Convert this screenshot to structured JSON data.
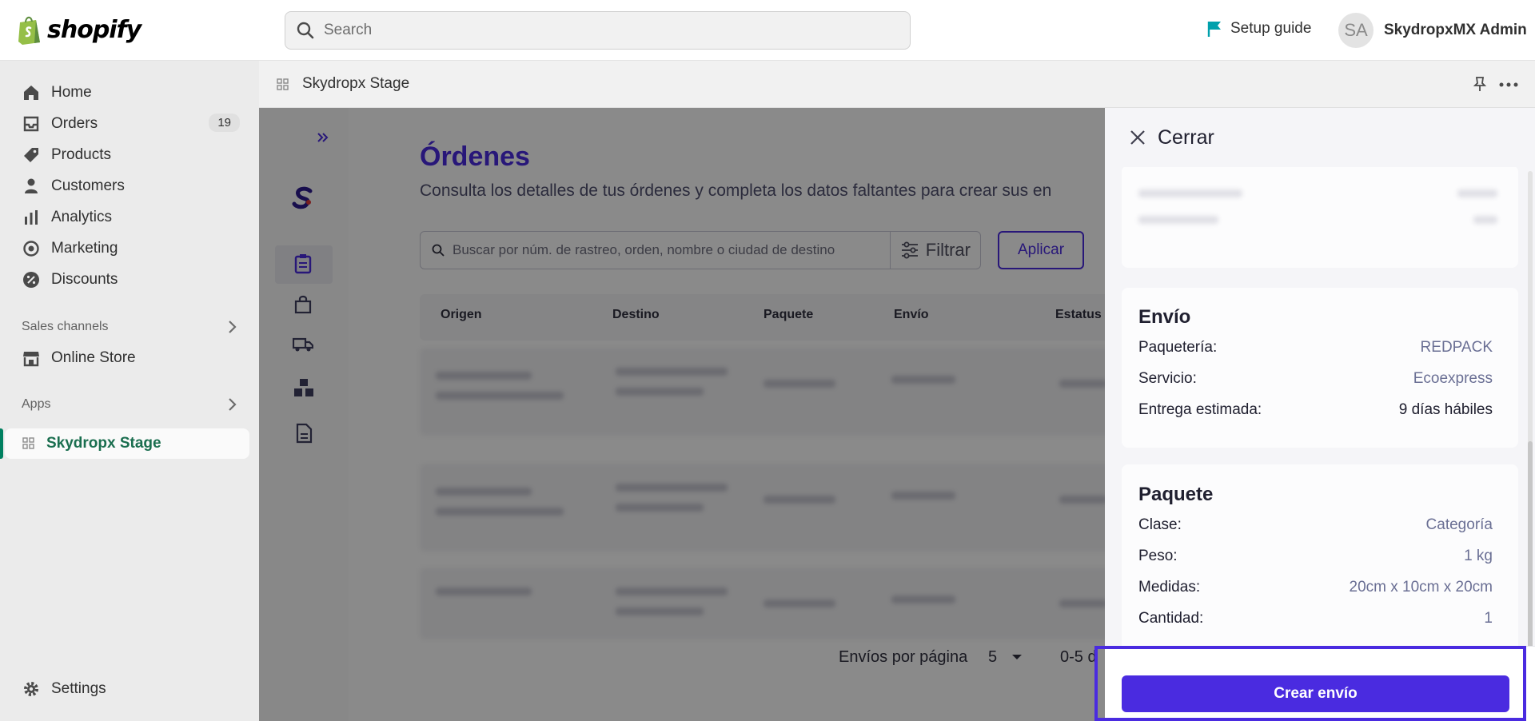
{
  "topbar": {
    "brand": "shopify",
    "search_placeholder": "Search",
    "setup_guide": "Setup guide",
    "avatar_initials": "SA",
    "user_name": "SkydropxMX Admin"
  },
  "sidebar": {
    "items": [
      {
        "label": "Home",
        "icon": "home-icon"
      },
      {
        "label": "Orders",
        "icon": "inbox-icon",
        "badge": "19"
      },
      {
        "label": "Products",
        "icon": "tag-icon"
      },
      {
        "label": "Customers",
        "icon": "person-icon"
      },
      {
        "label": "Analytics",
        "icon": "bar-chart-icon"
      },
      {
        "label": "Marketing",
        "icon": "target-icon"
      },
      {
        "label": "Discounts",
        "icon": "discount-icon"
      }
    ],
    "sales_channels_label": "Sales channels",
    "online_store": "Online Store",
    "apps_label": "Apps",
    "active_app": "Skydropx Stage",
    "settings": "Settings"
  },
  "app_header": {
    "title": "Skydropx Stage"
  },
  "app": {
    "title": "Órdenes",
    "subtitle": "Consulta los detalles de tus órdenes y completa los datos faltantes para crear sus en",
    "search_placeholder": "Buscar por núm. de rastreo, orden, nombre o ciudad de destino",
    "filter_label": "Filtrar",
    "apply_label": "Aplicar",
    "columns": [
      "Origen",
      "Destino",
      "Paquete",
      "Envío",
      "Estatus"
    ],
    "per_page_label": "Envíos por página",
    "per_page_value": "5",
    "range_text": "0-5 d"
  },
  "drawer": {
    "close_label": "Cerrar",
    "shipping": {
      "title": "Envío",
      "rows": [
        {
          "label": "Paquetería:",
          "value": "REDPACK"
        },
        {
          "label": "Servicio:",
          "value": "Ecoexpress"
        },
        {
          "label": "Entrega estimada:",
          "value": "9 días hábiles"
        }
      ]
    },
    "package": {
      "title": "Paquete",
      "rows": [
        {
          "label": "Clase:",
          "value": "Categoría"
        },
        {
          "label": "Peso:",
          "value": "1 kg"
        },
        {
          "label": "Medidas:",
          "value": "20cm x 10cm x 20cm"
        },
        {
          "label": "Cantidad:",
          "value": "1"
        }
      ]
    },
    "cta_label": "Crear envío"
  },
  "colors": {
    "brand_purple": "#4a2be0",
    "shopify_green": "#008060"
  }
}
